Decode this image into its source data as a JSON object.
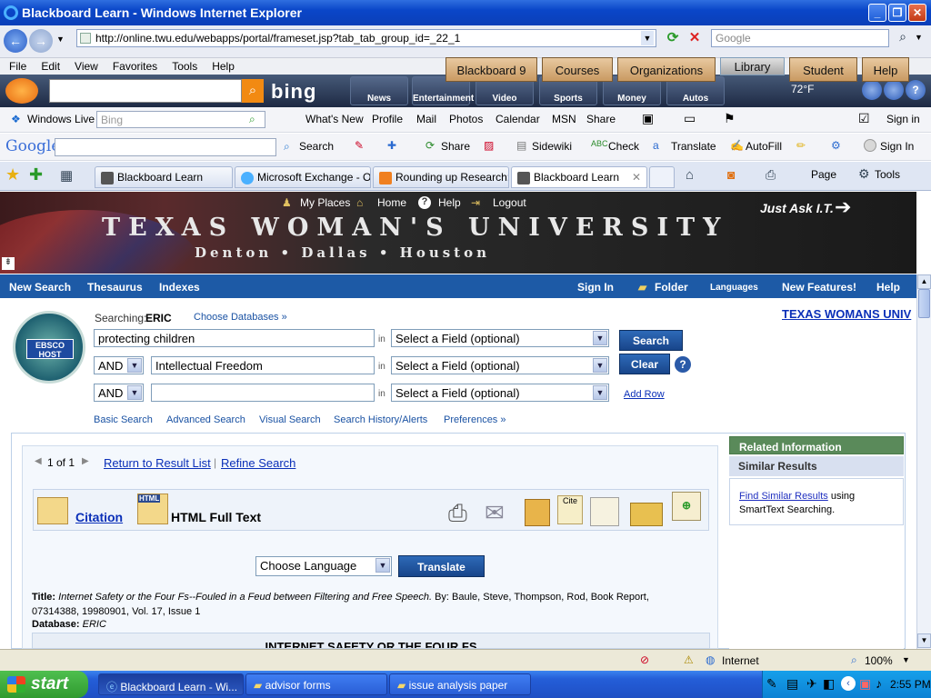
{
  "window": {
    "title": "Blackboard Learn - Windows Internet Explorer",
    "url": "http://online.twu.edu/webapps/portal/frameset.jsp?tab_tab_group_id=_22_1",
    "search_placeholder": "Google"
  },
  "menu": [
    "File",
    "Edit",
    "View",
    "Favorites",
    "Tools",
    "Help"
  ],
  "bing_bar": {
    "logo": "bing",
    "tiles": [
      "News",
      "Entertainment",
      "Video",
      "Sports",
      "Money",
      "Autos"
    ],
    "weather": "72°F"
  },
  "live_bar": {
    "label": "Windows Live",
    "search_placeholder": "Bing",
    "links": [
      "What's New",
      "Profile",
      "Mail",
      "Photos",
      "Calendar",
      "MSN",
      "Share"
    ],
    "signin": "Sign in"
  },
  "google_bar": {
    "logo": "Google",
    "items": [
      "Search",
      "Share",
      "Sidewiki",
      "Check",
      "Translate",
      "AutoFill"
    ],
    "signin": "Sign In"
  },
  "tabs": [
    "Blackboard Learn",
    "Microsoft Exchange - O...",
    "Rounding up Research:...",
    "Blackboard Learn"
  ],
  "cmd_bar": {
    "page": "Page",
    "tools": "Tools"
  },
  "twu": {
    "title": "TEXAS WOMAN'S UNIVERSITY",
    "subtitle": "Denton • Dallas • Houston",
    "nav": [
      "My Places",
      "Home",
      "Help",
      "Logout"
    ],
    "ask": "Just Ask I.T.",
    "tabs": [
      "Blackboard 9",
      "Courses",
      "Organizations",
      "Library",
      "Student",
      "Help"
    ]
  },
  "ebsco_bar": {
    "left": [
      "New Search",
      "Thesaurus",
      "Indexes"
    ],
    "right": [
      "Sign In",
      "Folder",
      "Languages",
      "New Features!",
      "Help"
    ]
  },
  "search": {
    "searching_label": "Searching:",
    "database": "ERIC",
    "choose_db": "Choose Databases »",
    "institution": "TEXAS WOMANS UNIV",
    "logo": "EBSCO HOST",
    "rows": [
      {
        "op": "",
        "term": "protecting children",
        "field": "Select a Field (optional)"
      },
      {
        "op": "AND",
        "term": "Intellectual Freedom",
        "field": "Select a Field (optional)"
      },
      {
        "op": "AND",
        "term": "",
        "field": "Select a Field (optional)"
      }
    ],
    "in_label": "in",
    "search_btn": "Search",
    "clear_btn": "Clear",
    "add_row": "Add Row",
    "links": [
      "Basic Search",
      "Advanced Search",
      "Visual Search",
      "Search History/Alerts",
      "Preferences »"
    ]
  },
  "result": {
    "pager": "1 of 1",
    "return_link": "Return to Result List",
    "refine_link": "Refine Search",
    "citation": "Citation",
    "fulltext": "HTML Full Text",
    "language": "Choose Language",
    "translate": "Translate",
    "title_label": "Title:",
    "title_text": "Internet Safety or the Four Fs--Fouled in a Feud between Filtering and Free Speech.",
    "by_text": " By: Baule, Steve, Thompson, Rod, Book Report, 07314388, 19980901, Vol. 17, Issue 1",
    "db_label": "Database:",
    "db_value": "ERIC",
    "article_heading": "INTERNET SAFETY OR THE FOUR FS"
  },
  "sidebar": {
    "related": "Related Information",
    "similar": "Similar Results",
    "find_link": "Find Similar Results",
    "find_text": " using SmartText Searching."
  },
  "status": {
    "zone": "Internet",
    "zoom": "100%"
  },
  "taskbar": {
    "start": "start",
    "tasks": [
      "Blackboard Learn - Wi...",
      "advisor forms",
      "issue analysis paper"
    ],
    "clock": "2:55 PM"
  }
}
